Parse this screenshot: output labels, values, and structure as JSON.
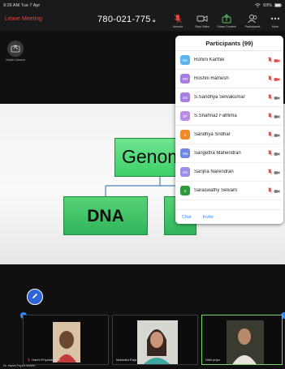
{
  "status_bar": {
    "time_date": "9:26 AM  Tue 7 Apr",
    "battery": "93%"
  },
  "toolbar": {
    "leave_label": "Leave Meeting",
    "meeting_id": "780-021-775",
    "tools": [
      {
        "label": "Unmute",
        "icon": "muted-mic-icon"
      },
      {
        "label": "Stop Video",
        "icon": "video-camera-icon"
      },
      {
        "label": "Share Content",
        "icon": "share-icon"
      },
      {
        "label": "Participants",
        "icon": "participants-icon"
      },
      {
        "label": "More",
        "icon": "more-icon"
      }
    ]
  },
  "switch_camera_label": "Switch Camera",
  "slide": {
    "main": "Genom",
    "child": "DNA"
  },
  "participants": {
    "title": "Participants (99)",
    "people": [
      {
        "initials": "RK",
        "name": "Rohini Karthik",
        "color": "#5ab5f0"
      },
      {
        "initials": "RR",
        "name": "Roshni Ramesh",
        "color": "#a77de2"
      },
      {
        "initials": "SS",
        "name": "S.Sandhya Selvakumar",
        "color": "#a77de2"
      },
      {
        "initials": "SF",
        "name": "S.Shahnaz Fathima",
        "color": "#b88ce6"
      },
      {
        "initials": "S",
        "name": "Sandhya Sridhar",
        "color": "#f08a24"
      },
      {
        "initials": "SM",
        "name": "Sangetha Mahendran",
        "color": "#6f86e8"
      },
      {
        "initials": "SN",
        "name": "Sanjna Narendran",
        "color": "#9b8cea"
      },
      {
        "initials": "S",
        "name": "Saraswathy Selvam",
        "color": "#2e9a3c"
      }
    ],
    "chat_label": "Chat",
    "invite_label": "Invite"
  },
  "thumbnails": [
    {
      "name": "Harini Priyadarshini"
    },
    {
      "name": "Malavika Raja"
    },
    {
      "name": "Nithi priya"
    }
  ],
  "caption": "Dr. Harini Priya's screen",
  "colors": {
    "leave": "#e5453b",
    "accent": "#2d8cff",
    "active_border": "#7bd36b",
    "slide_box": "#4fd87a"
  }
}
